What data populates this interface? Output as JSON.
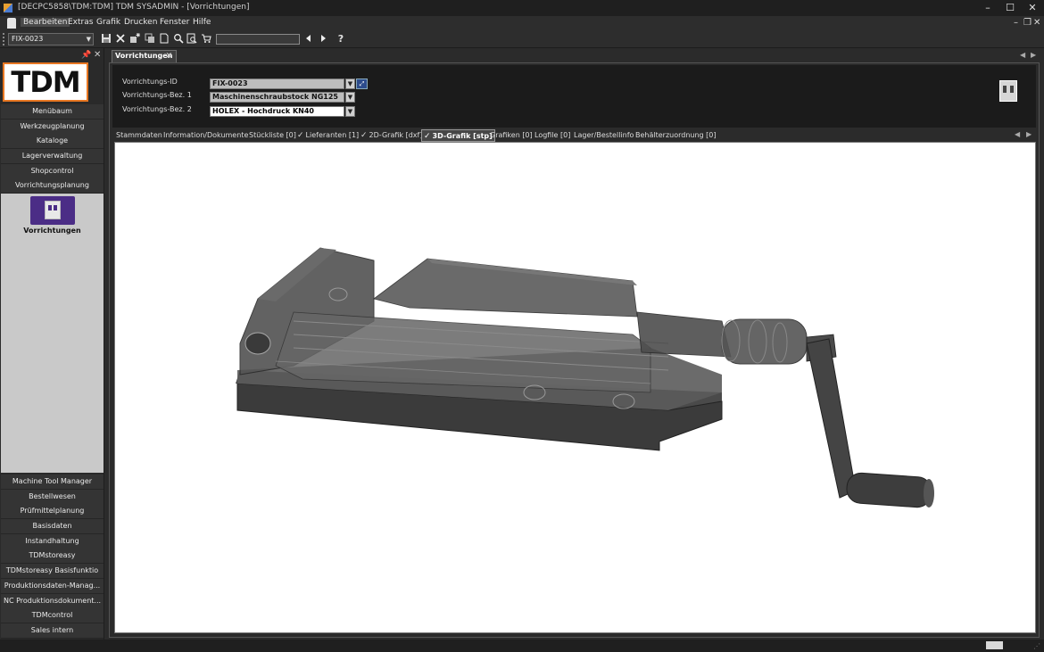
{
  "window": {
    "title": "[DECPC5858\\TDM:TDM] TDM SYSADMIN - [Vorrichtungen]",
    "minimize": "–",
    "maximize": "☐",
    "close": "✕"
  },
  "menu": {
    "items": [
      "Bearbeiten",
      "Extras",
      "Grafik",
      "Drucken",
      "Fenster",
      "Hilfe"
    ],
    "mdi_minimize": "–",
    "mdi_restore": "❐",
    "mdi_close": "✕"
  },
  "toolbar": {
    "fixture_selector_value": "FIX-0023",
    "search_value": ""
  },
  "sidebar": {
    "logo_text": "TDM",
    "top_items": [
      "Menübaum",
      "Werkzeugplanung",
      "Kataloge",
      "Lagerverwaltung",
      "Shopcontrol",
      "Vorrichtungsplanung"
    ],
    "panel_tile_label": "Vorrichtungen",
    "bottom_items": [
      "Machine Tool Manager",
      "Bestellwesen",
      "Prüfmittelplanung",
      "Basisdaten",
      "Instandhaltung",
      "TDMstoreasy",
      "TDMstoreasy Basisfunktio",
      "Produktionsdaten-Manag...",
      "NC Produktionsdokument...",
      "TDMcontrol",
      "Sales intern"
    ]
  },
  "document_tab": {
    "label": "Vorrichtungen",
    "close": "✕"
  },
  "header": {
    "fields": [
      {
        "label": "Vorrichtungs-ID",
        "value": "FIX-0023"
      },
      {
        "label": "Vorrichtungs-Bez. 1",
        "value": "Maschinenschraubstock NG125"
      },
      {
        "label": "Vorrichtungs-Bez. 2",
        "value": "HOLEX - Hochdruck KN40"
      }
    ]
  },
  "subtabs": {
    "items": [
      {
        "label": "Stammdaten",
        "checked": false
      },
      {
        "label": "Information/Dokumente",
        "checked": false
      },
      {
        "label": "Stückliste [0]",
        "checked": false
      },
      {
        "label": "Lieferanten [1]",
        "checked": true
      },
      {
        "label": "2D-Grafik [dxf]",
        "checked": true
      },
      {
        "label": "3D-Grafik [stp]",
        "checked": true,
        "active": true
      },
      {
        "label": "Grafiken [0]",
        "checked": false
      },
      {
        "label": "Logfile [0]",
        "checked": false
      },
      {
        "label": "Lager/Bestellinfo",
        "checked": false
      },
      {
        "label": "Behälterzuordnung [0]",
        "checked": false
      }
    ],
    "check_glyph": "✓"
  },
  "colors": {
    "background": "#2b2b2b",
    "header_panel": "#1b1b1b",
    "nav_panel": "#c9c9c9",
    "logo_border": "#e87722",
    "tile_icon": "#4b2d86",
    "viewer": "#ffffff"
  },
  "icons": {
    "toolbar": [
      "save-icon",
      "delete-icon",
      "new-icon",
      "copy-icon",
      "document-icon",
      "search-icon",
      "search-document-icon",
      "cart-icon",
      "arrow-left-icon",
      "arrow-right-icon",
      "help-icon"
    ],
    "viewer_model": "machine-vise-3d-model"
  }
}
